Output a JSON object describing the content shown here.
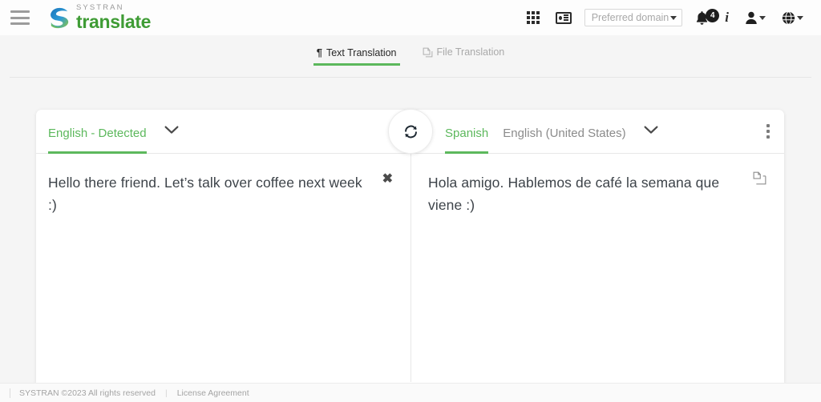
{
  "brand": {
    "sup": "SYSTRAN",
    "name": "translate",
    "logo_icon": "systran-swirl-logo",
    "menu_icon": "hamburger-menu-icon"
  },
  "header": {
    "apps_icon": "apps-grid-icon",
    "contact_icon": "id-card-icon",
    "domain_select": {
      "label": "Preferred domain",
      "caret_icon": "caret-down-icon"
    },
    "notifications": {
      "icon": "bell-icon",
      "count": "4"
    },
    "info_icon": "info-icon",
    "info_label": "i",
    "account": {
      "icon": "user-icon",
      "caret_icon": "caret-down-icon"
    },
    "language": {
      "icon": "globe-icon",
      "caret_icon": "caret-down-icon"
    }
  },
  "tabs": [
    {
      "label": "Text Translation",
      "icon": "pilcrow-icon",
      "glyph": "¶",
      "active": true
    },
    {
      "label": "File Translation",
      "icon": "file-copy-icon",
      "active": false
    }
  ],
  "translator": {
    "source": {
      "language_label": "English - Detected",
      "chevron_icon": "chevron-down-icon",
      "text": "Hello there friend. Let’s talk over coffee next week :)",
      "clear_icon": "close-icon",
      "clear_glyph": "✖"
    },
    "swap": {
      "icon": "swap-languages-icon"
    },
    "target": {
      "language_primary": "Spanish",
      "language_secondary": "English (United States)",
      "chevron_icon": "chevron-down-icon",
      "text": "Hola amigo. Hablemos de café la semana que viene :)",
      "copy_icon": "copy-icon",
      "menu_icon": "kebab-menu-icon"
    }
  },
  "footer": {
    "copyright": "SYSTRAN ©2023 All rights reserved",
    "license_link": "License Agreement"
  },
  "colors": {
    "accent_green": "#5cb85c",
    "brand_green": "#3f9c35",
    "page_bg": "#f5f5f5",
    "text_dark": "#3d4349",
    "text_muted": "#a9a9a9"
  }
}
